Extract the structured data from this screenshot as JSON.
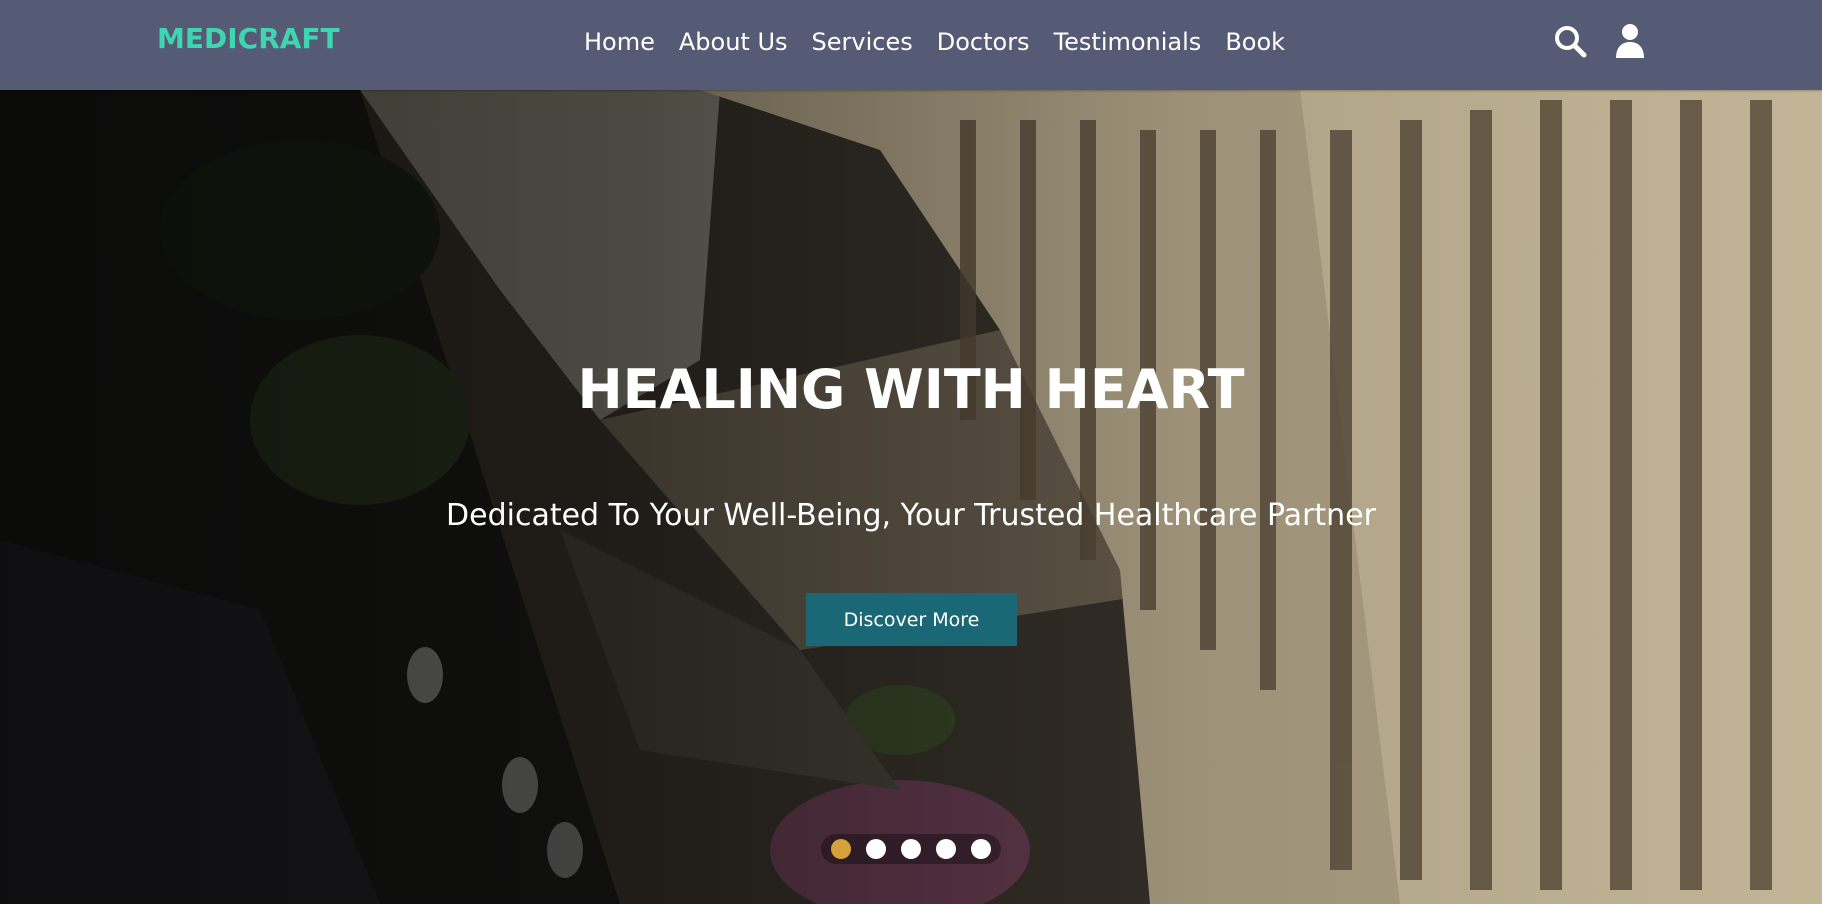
{
  "brand": {
    "logo_text": "MEDICRAFT",
    "logo_color": "#3ed6b0"
  },
  "nav": {
    "links": [
      "Home",
      "About Us",
      "Services",
      "Doctors",
      "Testimonials",
      "Book"
    ],
    "icons": [
      "search-icon",
      "user-icon"
    ],
    "background": "#555a75"
  },
  "hero": {
    "title": "HEALING WITH HEART",
    "subtitle": "Dedicated To Your Well-Being, Your Trusted Healthcare Partner",
    "cta_label": "Discover More",
    "cta_color": "#1a6875",
    "background": "aerial photo of hospital building",
    "slides": {
      "count": 5,
      "active": 1,
      "active_color": "#d4a13b"
    }
  }
}
